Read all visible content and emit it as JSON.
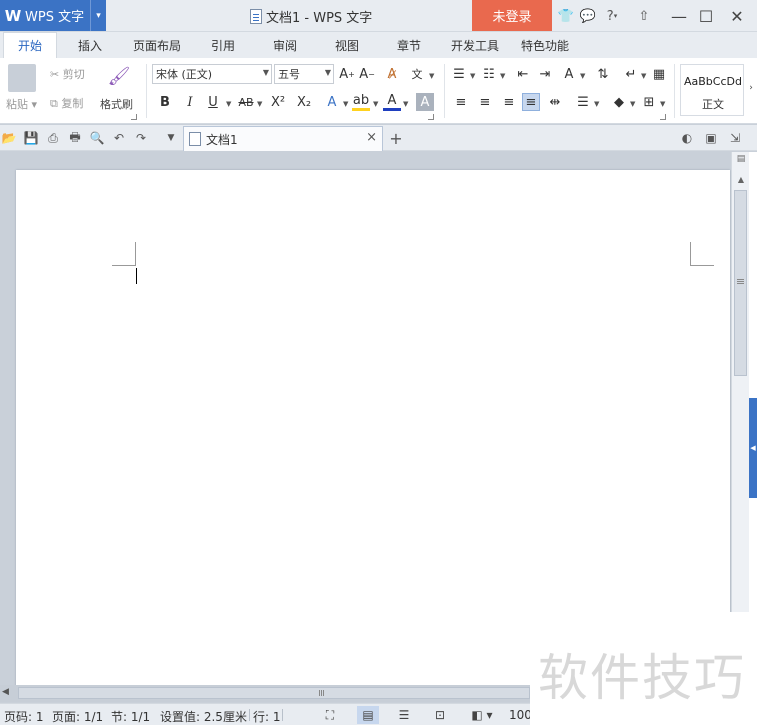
{
  "app": {
    "name": "WPS 文字",
    "logo_letter": "W"
  },
  "window": {
    "title": "文档1 - WPS 文字",
    "login_label": "未登录",
    "help_label": "?"
  },
  "tabs": [
    {
      "label": "开始",
      "active": true
    },
    {
      "label": "插入"
    },
    {
      "label": "页面布局"
    },
    {
      "label": "引用"
    },
    {
      "label": "审阅"
    },
    {
      "label": "视图"
    },
    {
      "label": "章节"
    },
    {
      "label": "开发工具"
    },
    {
      "label": "特色功能"
    }
  ],
  "ribbon": {
    "paste_label": "粘贴",
    "cut_label": "剪切",
    "copy_label": "复制",
    "format_painter_label": "格式刷",
    "font_name": "宋体 (正文)",
    "font_size": "五号",
    "bold": "B",
    "italic": "I",
    "underline": "U",
    "strike": "AB",
    "superscript": "X²",
    "subscript": "X₂",
    "font_color_letter": "A",
    "char_shade_letter": "A",
    "style_sample": "AaBbCcDd",
    "style_name": "正文"
  },
  "document": {
    "tab_title": "文档1"
  },
  "status": {
    "page": "页码: 1",
    "pages": "页面: 1/1",
    "section": "节: 1/1",
    "setting": "设置值: 2.5厘米",
    "line": "行: 1",
    "zoom": "100"
  },
  "watermark": {
    "text": "软件技巧"
  },
  "colors": {
    "accent": "#3b73c5",
    "login": "#e9694e"
  }
}
